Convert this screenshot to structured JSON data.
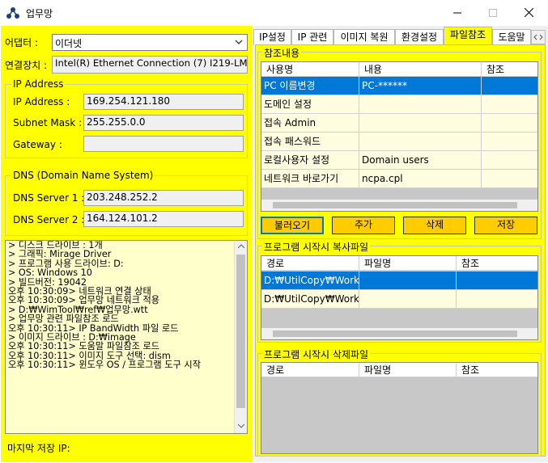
{
  "window": {
    "title": "업무망"
  },
  "left": {
    "adapter_label": "어댑터 :",
    "adapter_value": "이더넷",
    "device_label": "연결장치 :",
    "device_value": "Intel(R) Ethernet Connection (7) I219-LM",
    "ip_group": "IP Address",
    "ip_label": "IP Address :",
    "ip_value": "169.254.121.180",
    "mask_label": "Subnet Mask :",
    "mask_value": "255.255.0.0",
    "gw_label": "Gateway :",
    "gw_value": "",
    "dns_group": "DNS (Domain Name System)",
    "dns1_label": "DNS Server 1 :",
    "dns1_value": "203.248.252.2",
    "dns2_label": "DNS Server 2 :",
    "dns2_value": "164.124.101.2",
    "log_lines": [
      "> 디스크 드라이브 : 1개",
      "> 그래픽: Mirage Driver",
      "> 프로그램 사용 드라이브: D:",
      "> OS: Windows 10",
      "> 빌드버전: 19042",
      "오후 10:30:09> 네트워크 연결 상태",
      "오후 10:30:09> 업무망 네트워크 적용",
      "> D:₩WimTool₩ref₩업무망.wtt",
      "> 업무망 관련 파일참조 로드",
      "오후 10:30:11> IP BandWidth 파일 로드",
      "> 이미지 드라이브 : D:₩image",
      "오후 10:30:11> 도움말 파일참조 로드",
      "오후 10:30:11> 이미지 도구 선택: dism",
      "오후 10:30:11> 윈도우 OS / 프로그램 도구 시작"
    ],
    "last_save_label": "마지막 저장 IP:"
  },
  "tabs": [
    "IP설정",
    "IP 관련",
    "이미지 복원",
    "환경설정",
    "파일참조",
    "도움말"
  ],
  "ref": {
    "group": "참조내용",
    "headers": [
      "사용명",
      "내용",
      "참조"
    ],
    "rows": [
      [
        "PC 이름변경",
        "PC-******",
        ""
      ],
      [
        "도메인 설정",
        "",
        ""
      ],
      [
        "접속 Admin",
        "",
        ""
      ],
      [
        "접속 패스워드",
        "",
        ""
      ],
      [
        "로컬사용자 설정",
        "Domain users",
        ""
      ],
      [
        "네트워크 바로가기",
        "ncpa.cpl",
        ""
      ]
    ],
    "buttons": [
      "불러오기",
      "추가",
      "삭제",
      "저장"
    ]
  },
  "copy": {
    "group": "프로그램 시작시 복사파일",
    "headers": [
      "경로",
      "파일명",
      "참조"
    ],
    "rows": [
      [
        "D:₩UtilCopy₩Work",
        "",
        ""
      ],
      [
        "D:₩UtilCopy₩Work",
        "",
        ""
      ]
    ]
  },
  "del": {
    "group": "프로그램 시작시 삭제파일",
    "headers": [
      "경로",
      "파일명",
      "참조"
    ]
  },
  "colors": {
    "panel": "#ffff00",
    "button": "#ffcc00",
    "selection": "#0078d7"
  }
}
